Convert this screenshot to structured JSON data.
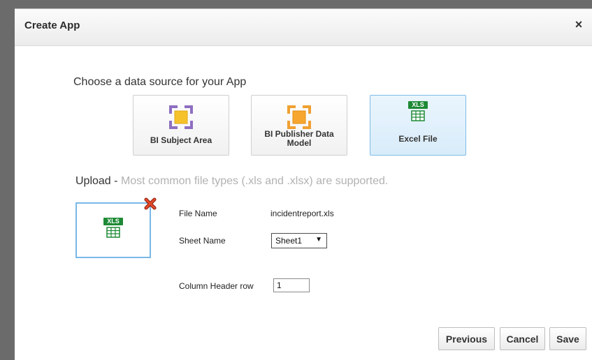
{
  "dialog": {
    "title": "Create App",
    "close_label": "×"
  },
  "datasource": {
    "heading": "Choose a data source for your App",
    "tiles": [
      {
        "label": "BI Subject Area",
        "icon": "subject-area-icon",
        "color": "#8e6fc1",
        "selected": false
      },
      {
        "label": "BI Publisher Data Model",
        "icon": "data-model-icon",
        "color": "#f0a032",
        "selected": false
      },
      {
        "label": "Excel File",
        "icon": "excel-file-icon",
        "badge": "XLS",
        "selected": true
      }
    ]
  },
  "upload": {
    "title": "Upload -",
    "hint": "Most common file types (.xls and .xlsx) are supported.",
    "preview_badge": "XLS",
    "file_name_label": "File Name",
    "file_name_value": "incidentreport.xls",
    "sheet_name_label": "Sheet Name",
    "sheet_name_value": "Sheet1",
    "column_header_label": "Column Header row",
    "column_header_value": "1"
  },
  "buttons": {
    "previous": "Previous",
    "cancel": "Cancel",
    "save": "Save"
  },
  "colors": {
    "accent_border": "#79b8e6",
    "excel_green": "#1e8a36",
    "remove_red": "#d83a1e"
  }
}
